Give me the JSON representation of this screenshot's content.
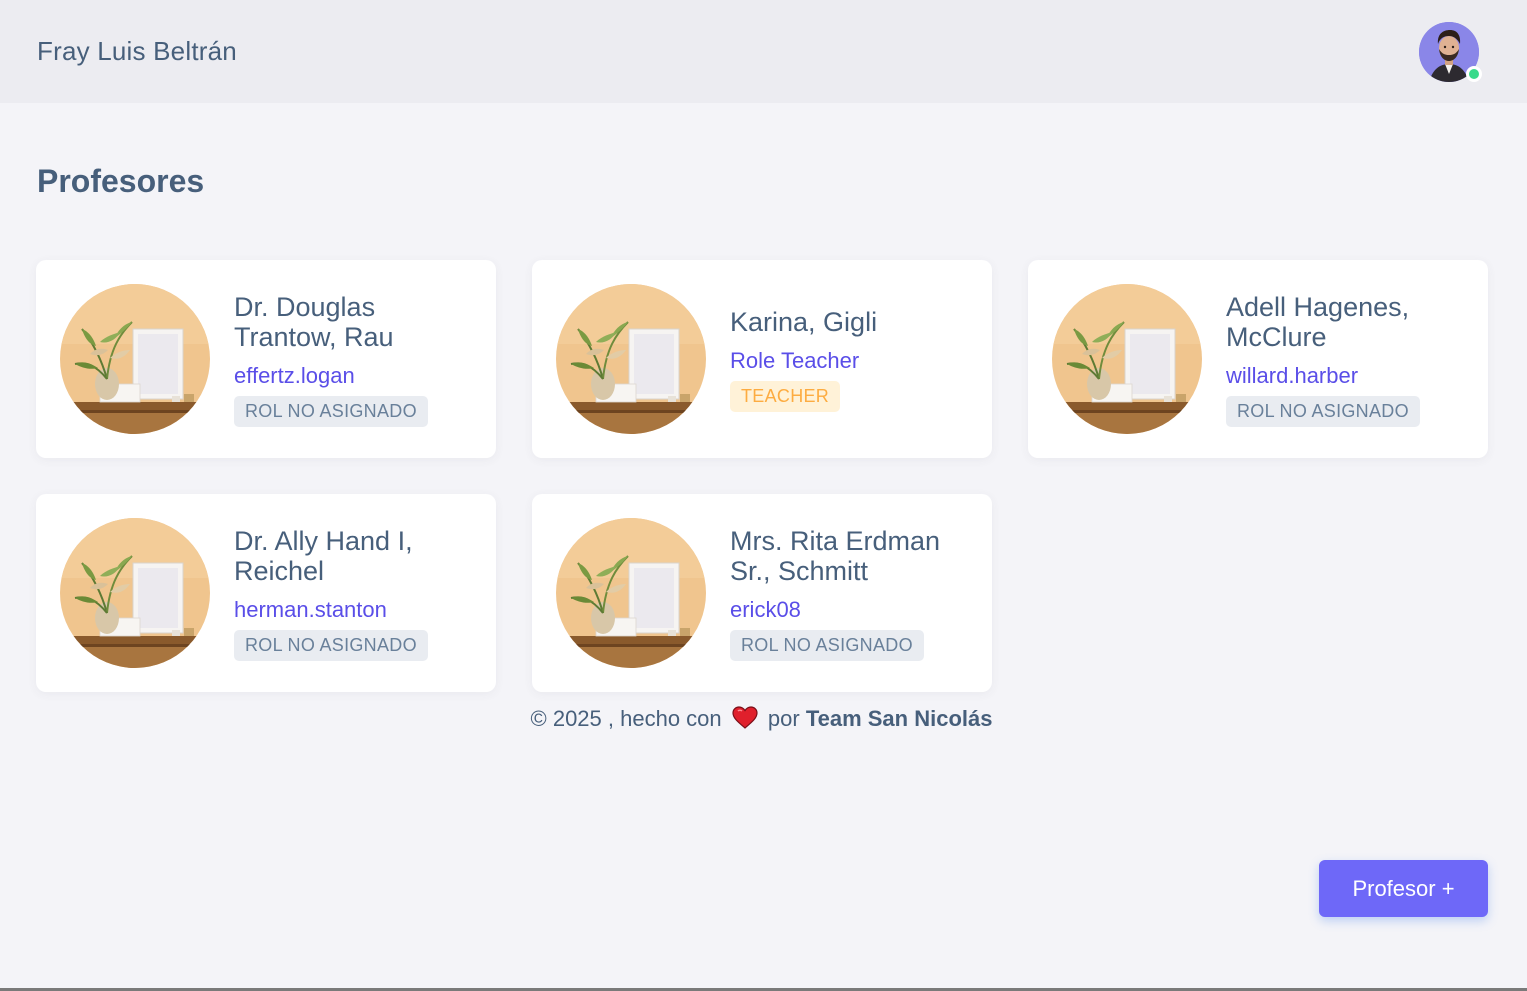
{
  "header": {
    "brand": "Fray Luis Beltrán",
    "user_status_color": "#39da8a"
  },
  "page": {
    "title": "Profesores"
  },
  "teachers": [
    {
      "name": "Dr. Douglas Trantow, Rau",
      "sub": "effertz.logan",
      "badge": "ROL NO ASIGNADO",
      "badge_style": "gray"
    },
    {
      "name": "Karina, Gigli",
      "sub": "Role Teacher",
      "badge": "TEACHER",
      "badge_style": "orange"
    },
    {
      "name": "Adell Hagenes, McClure",
      "sub": "willard.harber",
      "badge": "ROL NO ASIGNADO",
      "badge_style": "gray"
    },
    {
      "name": "Dr. Ally Hand I, Reichel",
      "sub": "herman.stanton",
      "badge": "ROL NO ASIGNADO",
      "badge_style": "gray"
    },
    {
      "name": "Mrs. Rita Erdman Sr., Schmitt",
      "sub": "erick08",
      "badge": "ROL NO ASIGNADO",
      "badge_style": "gray"
    }
  ],
  "footer": {
    "prefix": "© 2025 , hecho con",
    "middle": "por",
    "team": "Team San Nicolás",
    "heart_icon": "heart-icon"
  },
  "actions": {
    "add_teacher_label": "Profesor +"
  },
  "colors": {
    "accent": "#6e68f8",
    "link": "#5a4ee8",
    "text": "#475f7b",
    "badge_gray_bg": "#e9ecf1",
    "badge_orange_bg": "#fff2d8",
    "badge_orange_text": "#fdac41"
  }
}
